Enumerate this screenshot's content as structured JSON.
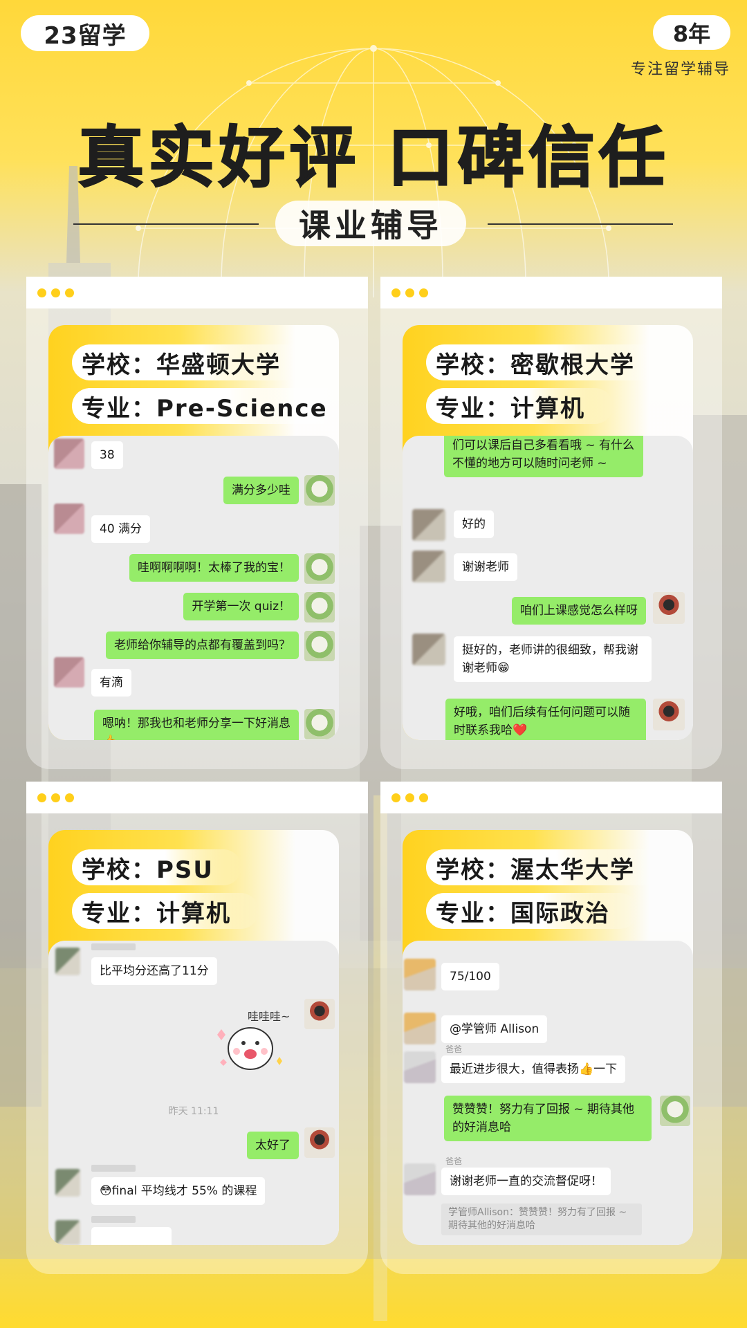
{
  "brand": {
    "logo": "23留学",
    "years": "8年",
    "slogan": "专注留学辅导"
  },
  "headline": "真实好评 口碑信任",
  "section_title": "课业辅导",
  "colors": {
    "brand_yellow": "#ffd21f",
    "wechat_green": "#95ec69",
    "chat_bg": "#ececec"
  },
  "panels": [
    {
      "school": "学校：华盛顿大学",
      "major": "专业：Pre-Science",
      "messages": {
        "m1": "38",
        "m2": "满分多少哇",
        "m3": "40 满分",
        "m4": "哇啊啊啊啊！太棒了我的宝！",
        "m5": "开学第一次 quiz！",
        "m6": "老师给你辅导的点都有覆盖到吗？",
        "m7": "有滴",
        "m8": "嗯呐！那我也和老师分享一下好消息👍"
      }
    },
    {
      "school": "学校：密歇根大学",
      "major": "专业：计算机",
      "messages": {
        "m1": "们可以课后自己多看看哦 ~ 有什么不懂的地方可以随时问老师 ~",
        "m2": "好的",
        "m3": "谢谢老师",
        "m4": "咱们上课感觉怎么样呀",
        "m5": "挺好的，老师讲的很细致，帮我谢谢老师😁",
        "m6": "好哦，咱们后续有任何问题可以随时联系我哈❤️"
      }
    },
    {
      "school": "学校：PSU",
      "major": "专业：计算机",
      "messages": {
        "m1": "比平均分还高了11分",
        "sticker_text": "哇哇哇~",
        "time": "昨天 11:11",
        "m2": "太好了",
        "m3": "😳final 平均线才 55% 的课程"
      }
    },
    {
      "school": "学校：渥太华大学",
      "major": "专业：国际政治",
      "messages": {
        "m1": "75/100",
        "m2": "@学管师 Allison",
        "name_a": "爸爸",
        "m3": "最近进步很大，值得表扬👍一下",
        "m4": "赞赞赞！努力有了回报 ~ 期待其他的好消息哈",
        "name_b": "爸爸",
        "m5": "谢谢老师一直的交流督促呀！",
        "quote": "学管师Allison：赞赞赞！努力有了回报 ~ 期待其他的好消息哈"
      }
    }
  ]
}
